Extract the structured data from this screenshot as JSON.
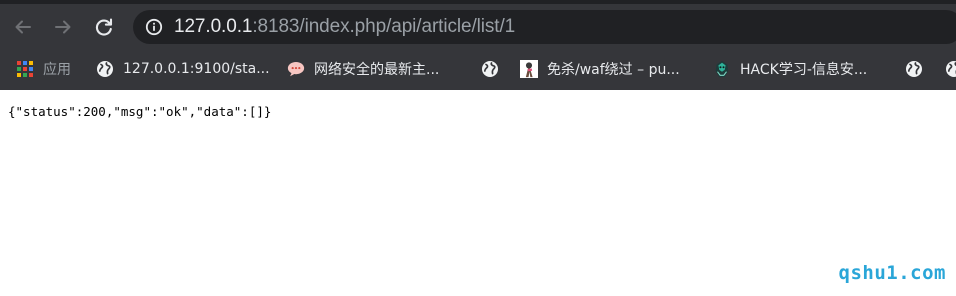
{
  "colors": {
    "toolbar_bg": "#35363a",
    "omnibox_bg": "#202124",
    "url_host": "#e8eaed",
    "url_rest": "#9aa0a6",
    "watermark": "#2aa6d8"
  },
  "toolbar": {
    "back_icon": "arrow-left-icon",
    "forward_icon": "arrow-right-icon",
    "reload_icon": "reload-icon",
    "site_info_icon": "info-circle-icon",
    "url_host": "127.0.0.1",
    "url_rest": ":8183/index.php/api/article/list/1"
  },
  "bookmarks": {
    "apps_label": "应用",
    "items": [
      {
        "label": "127.0.0.1:9100/sta...",
        "icon": "globe-icon"
      },
      {
        "label": "网络安全的最新主...",
        "icon": "chat-bubble-icon"
      },
      {
        "label": "",
        "icon": "globe-icon"
      },
      {
        "label": "免杀/waf绕过 – pu...",
        "icon": "portrait-icon"
      },
      {
        "label": "HACK学习-信息安...",
        "icon": "mascot-icon"
      },
      {
        "label": "",
        "icon": "globe-icon"
      },
      {
        "label": "",
        "icon": "globe-icon"
      }
    ]
  },
  "page": {
    "body_text": "{\"status\":200,\"msg\":\"ok\",\"data\":[]}"
  },
  "watermark": "qshu1.com"
}
